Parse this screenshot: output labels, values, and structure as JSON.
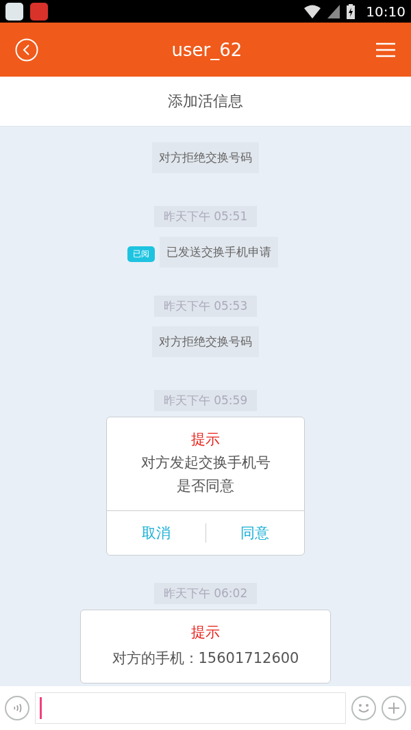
{
  "status_bar": {
    "time": "10:10"
  },
  "header": {
    "title": "user_62"
  },
  "subheader": {
    "title": "添加活信息"
  },
  "messages": [
    {
      "kind": "system",
      "text": "对方拒绝交换号码"
    },
    {
      "kind": "time",
      "text": "昨天下午 05:51"
    },
    {
      "kind": "sent",
      "text": "已发送交换手机申请",
      "badge": "已阅"
    },
    {
      "kind": "time",
      "text": "昨天下午 05:53"
    },
    {
      "kind": "system",
      "text": "对方拒绝交换号码"
    },
    {
      "kind": "time",
      "text": "昨天下午 05:59"
    },
    {
      "kind": "dialog",
      "title": "提示",
      "lines": [
        "对方发起交换手机号",
        "是否同意"
      ],
      "buttons": [
        "取消",
        "同意"
      ]
    },
    {
      "kind": "time",
      "text": "昨天下午 06:02"
    },
    {
      "kind": "card",
      "title": "提示",
      "lines": [
        "对方的手机：15601712600"
      ]
    }
  ]
}
